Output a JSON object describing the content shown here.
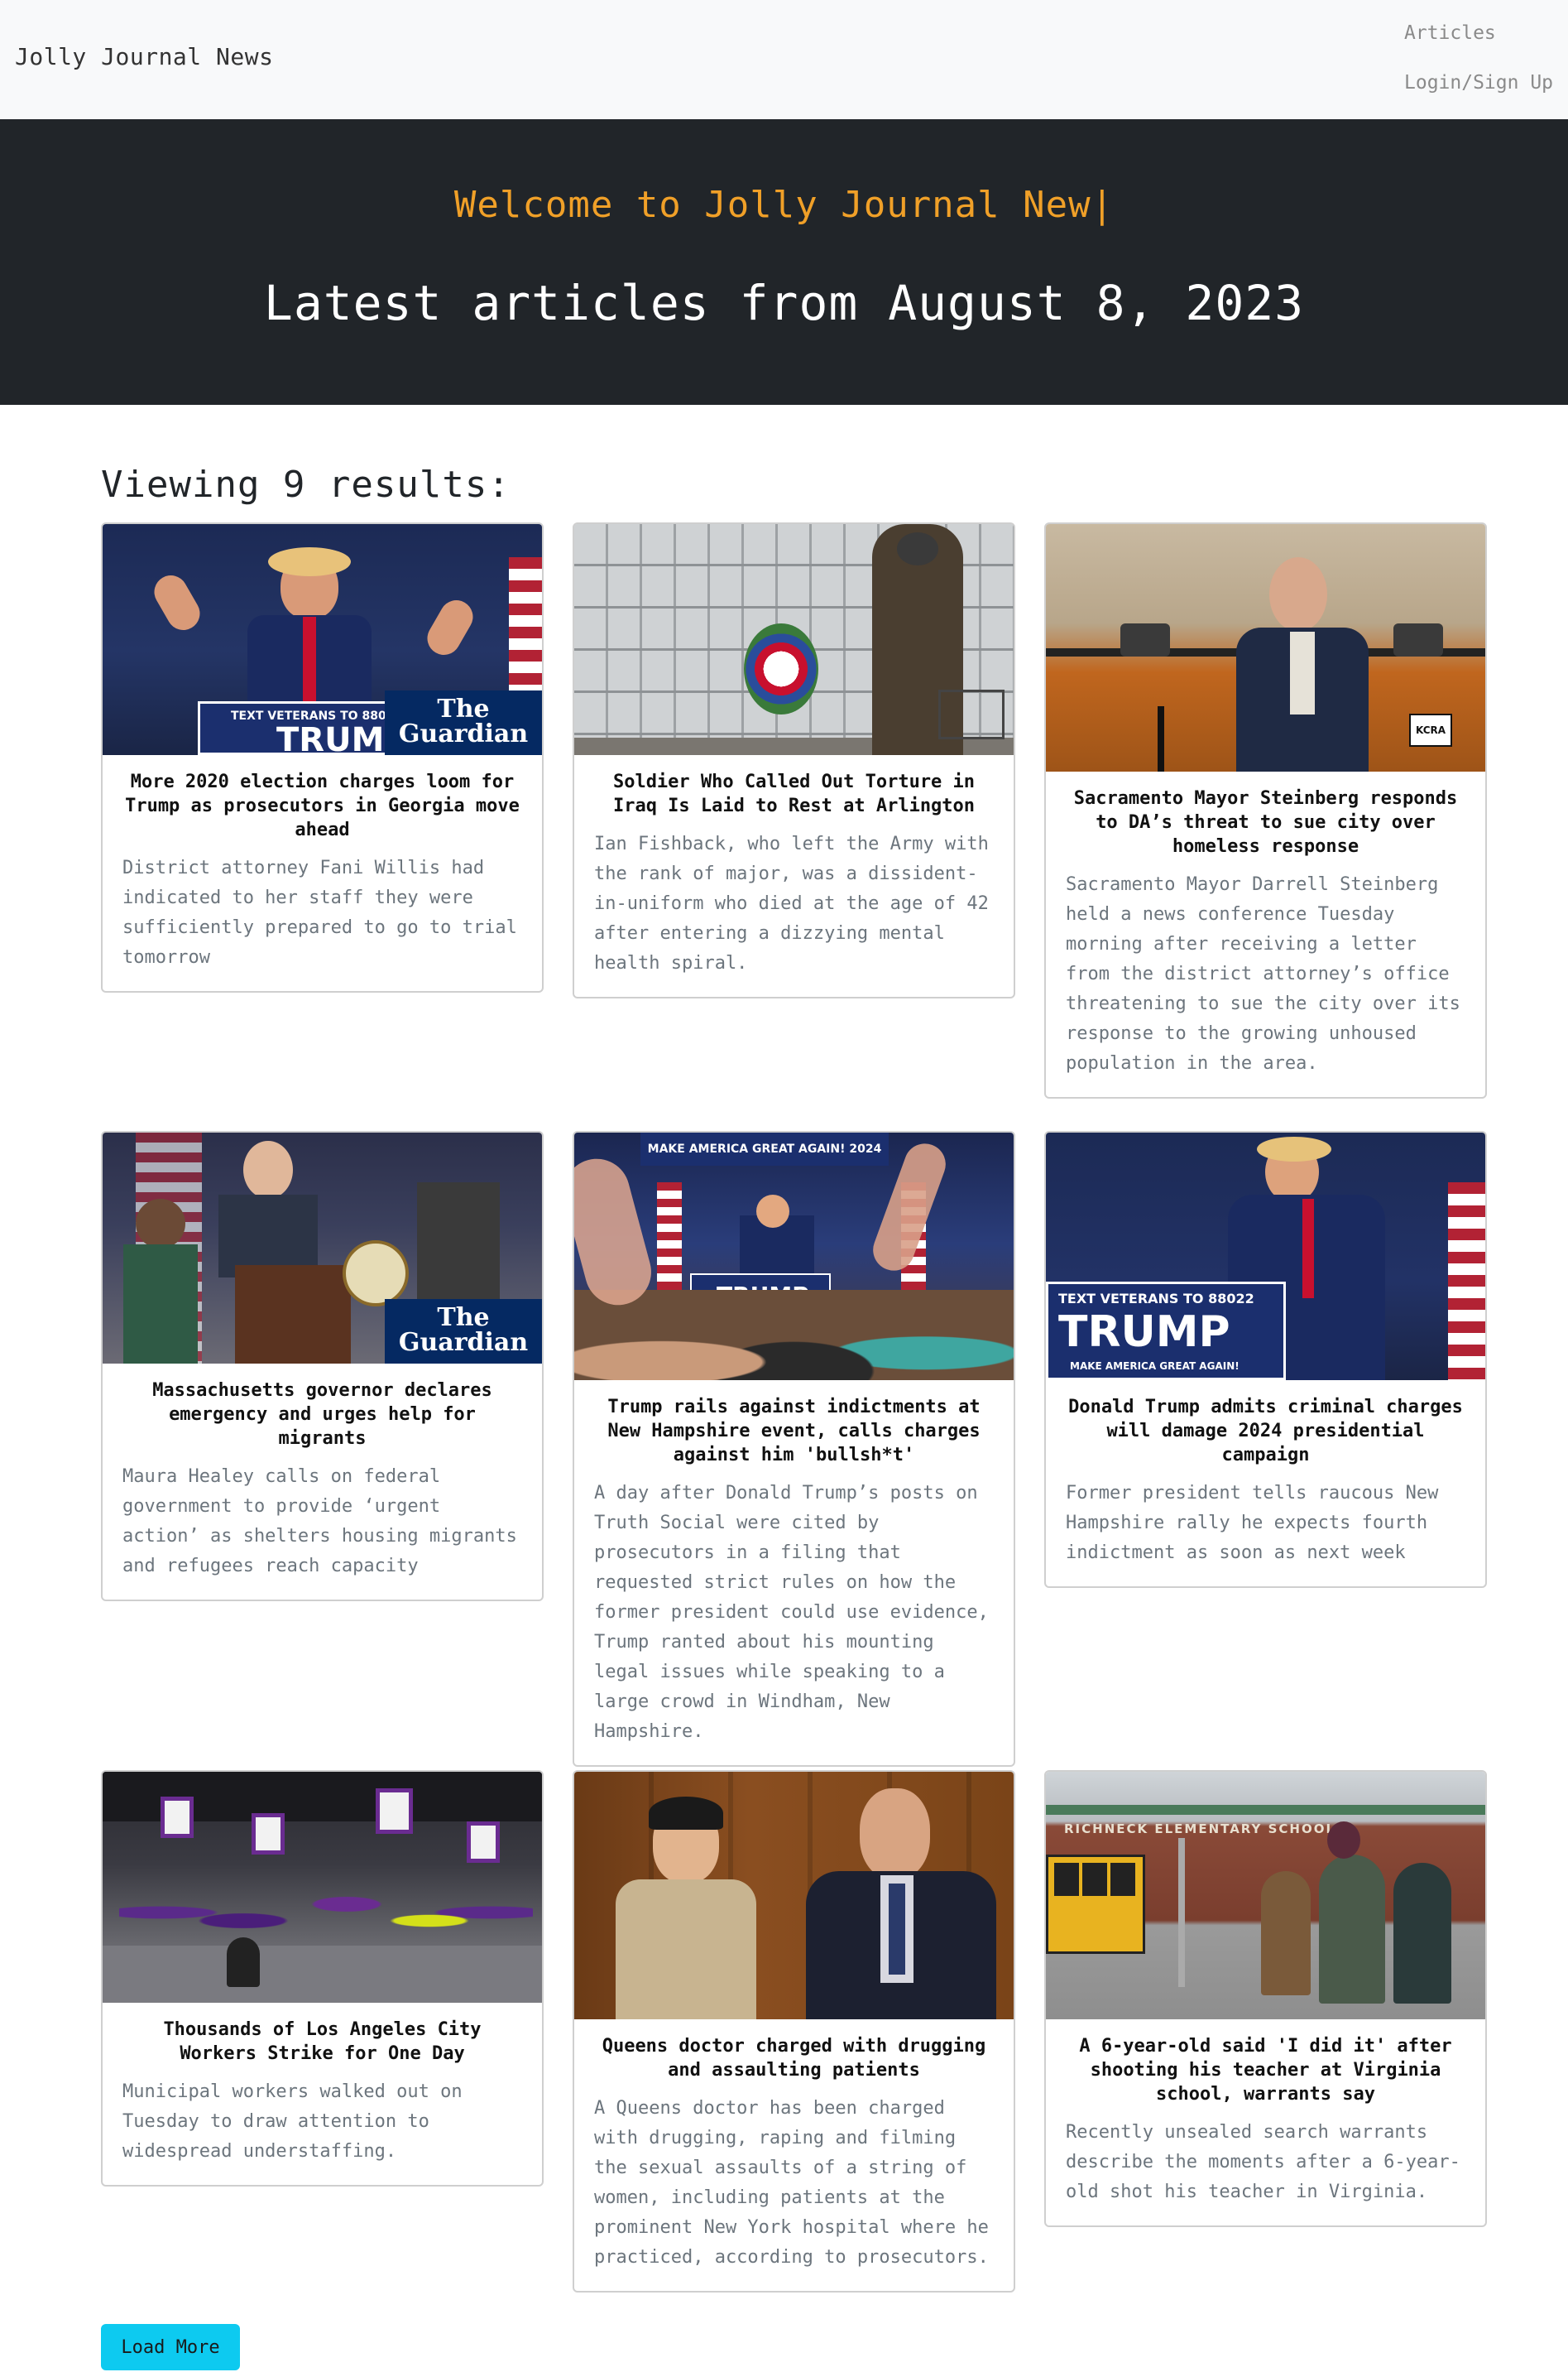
{
  "nav": {
    "brand": "Jolly Journal News",
    "links": [
      "Articles",
      "Login/Sign Up"
    ]
  },
  "hero": {
    "welcome": "Welcome to Jolly Journal New|",
    "latest": "Latest articles from August 8, 2023"
  },
  "results_label": "Viewing 9 results:",
  "articles": [
    {
      "title": "More 2020 election charges loom for Trump as prosecutors in Georgia move ahead",
      "summary": "District attorney Fani Willis had indicated to her staff they were sufficiently prepared to go to trial tomorrow",
      "image_overlay": "The Guardian",
      "image_sign": "TRUMP",
      "image_sign_small": "TEXT VETERANS TO 880"
    },
    {
      "title": "Soldier Who Called Out Torture in Iraq Is Laid to Rest at Arlington",
      "summary": "Ian Fishback, who left the Army with the rank of major, was a dissident-in-uniform who died at the age of 42 after entering a dizzying mental health spiral."
    },
    {
      "title": "Sacramento Mayor Steinberg responds to DA’s threat to sue city over homeless response",
      "summary": "Sacramento Mayor Darrell Steinberg held a news conference Tuesday morning after receiving a letter from the district attorney’s office threatening to sue the city over its response to the growing unhoused population in the area.",
      "image_overlay": "KCRA"
    },
    {
      "title": "Massachusetts governor declares emergency and urges help for migrants",
      "summary": "Maura Healey calls on federal government to provide ‘urgent action’ as shelters housing migrants and refugees reach capacity",
      "image_overlay": "The Guardian"
    },
    {
      "title": "Trump rails against indictments at New Hampshire event, calls charges against him 'bullsh*t'",
      "summary": "A day after Donald Trump’s posts on Truth Social were cited by prosecutors in a filing that requested strict rules on how the former president could use evidence, Trump ranted about his mounting legal issues while speaking to a large crowd in Windham, New Hampshire.",
      "image_sign": "TRUMP",
      "image_sign_small": "MAKE AMERICA GREAT AGAIN! 2024"
    },
    {
      "title": "Donald Trump admits criminal charges will damage 2024 presidential campaign",
      "summary": "Former president tells raucous New Hampshire rally he expects fourth indictment as soon as next week",
      "image_sign": "TRUMP",
      "image_sign_small": "TEXT VETERANS TO 88022",
      "image_sign_bottom": "MAKE AMERICA GREAT AGAIN!"
    },
    {
      "title": "Thousands of Los Angeles City Workers Strike for One Day",
      "summary": "Municipal workers walked out on Tuesday to draw attention to widespread understaffing."
    },
    {
      "title": "Queens doctor charged with drugging and assaulting patients",
      "summary": "A Queens doctor has been charged with drugging, raping and filming the sexual assaults of a string of women, including patients at the prominent New York hospital where he practiced, according to prosecutors."
    },
    {
      "title": "A 6-year-old said 'I did it' after shooting his teacher at Virginia school, warrants say",
      "summary": "Recently unsealed search warrants describe the moments after a 6-year-old shot his teacher in Virginia.",
      "image_sign": "RICHNECK ELEMENTARY SCHOOL"
    }
  ],
  "load_more": "Load More"
}
